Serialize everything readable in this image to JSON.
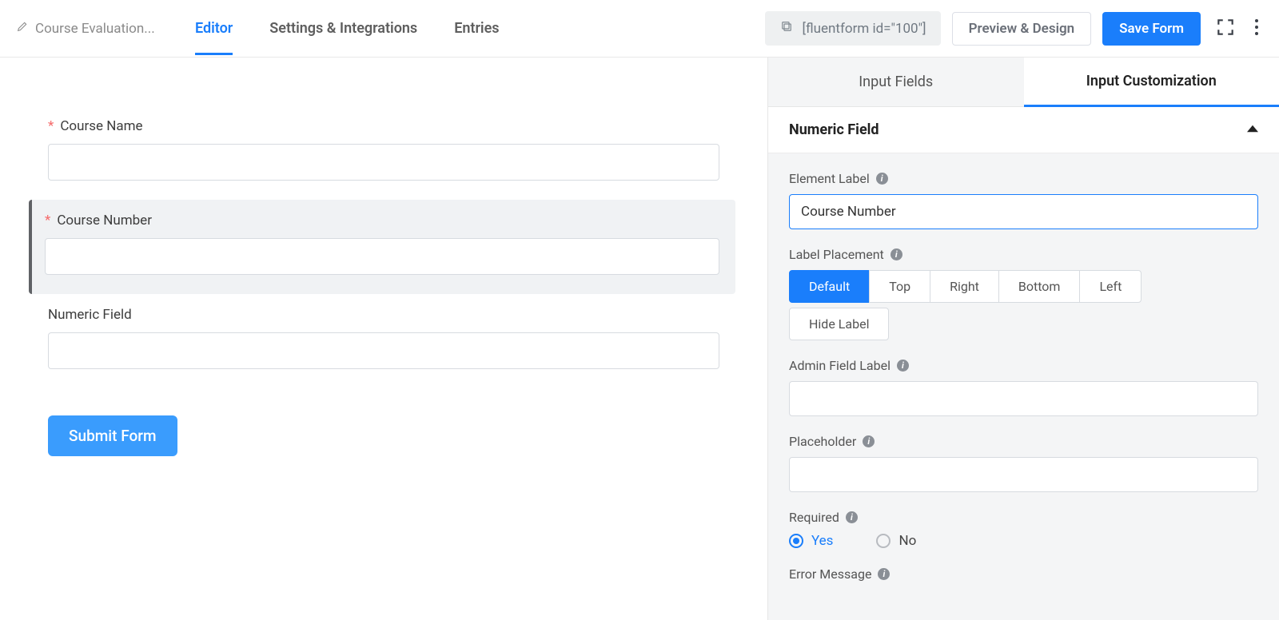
{
  "header": {
    "form_title": "Course Evaluation...",
    "tabs": [
      {
        "label": "Editor",
        "active": true
      },
      {
        "label": "Settings & Integrations",
        "active": false
      },
      {
        "label": "Entries",
        "active": false
      }
    ],
    "shortcode": "[fluentform id=\"100\"]",
    "preview_label": "Preview & Design",
    "save_label": "Save Form"
  },
  "form": {
    "fields": [
      {
        "label": "Course Name",
        "required": true,
        "selected": false
      },
      {
        "label": "Course Number",
        "required": true,
        "selected": true
      },
      {
        "label": "Numeric Field",
        "required": false,
        "selected": false
      }
    ],
    "submit_label": "Submit Form"
  },
  "sidepanel": {
    "tabs": [
      {
        "label": "Input Fields",
        "active": false
      },
      {
        "label": "Input Customization",
        "active": true
      }
    ],
    "section_title": "Numeric Field",
    "settings": {
      "element_label": {
        "caption": "Element Label",
        "value": "Course Number"
      },
      "label_placement": {
        "caption": "Label Placement",
        "options": [
          "Default",
          "Top",
          "Right",
          "Bottom",
          "Left"
        ],
        "extra": "Hide Label",
        "selected": "Default"
      },
      "admin_field_label": {
        "caption": "Admin Field Label",
        "value": ""
      },
      "placeholder": {
        "caption": "Placeholder",
        "value": ""
      },
      "required": {
        "caption": "Required",
        "options": [
          "Yes",
          "No"
        ],
        "selected": "Yes"
      },
      "error_message": {
        "caption": "Error Message"
      }
    }
  }
}
